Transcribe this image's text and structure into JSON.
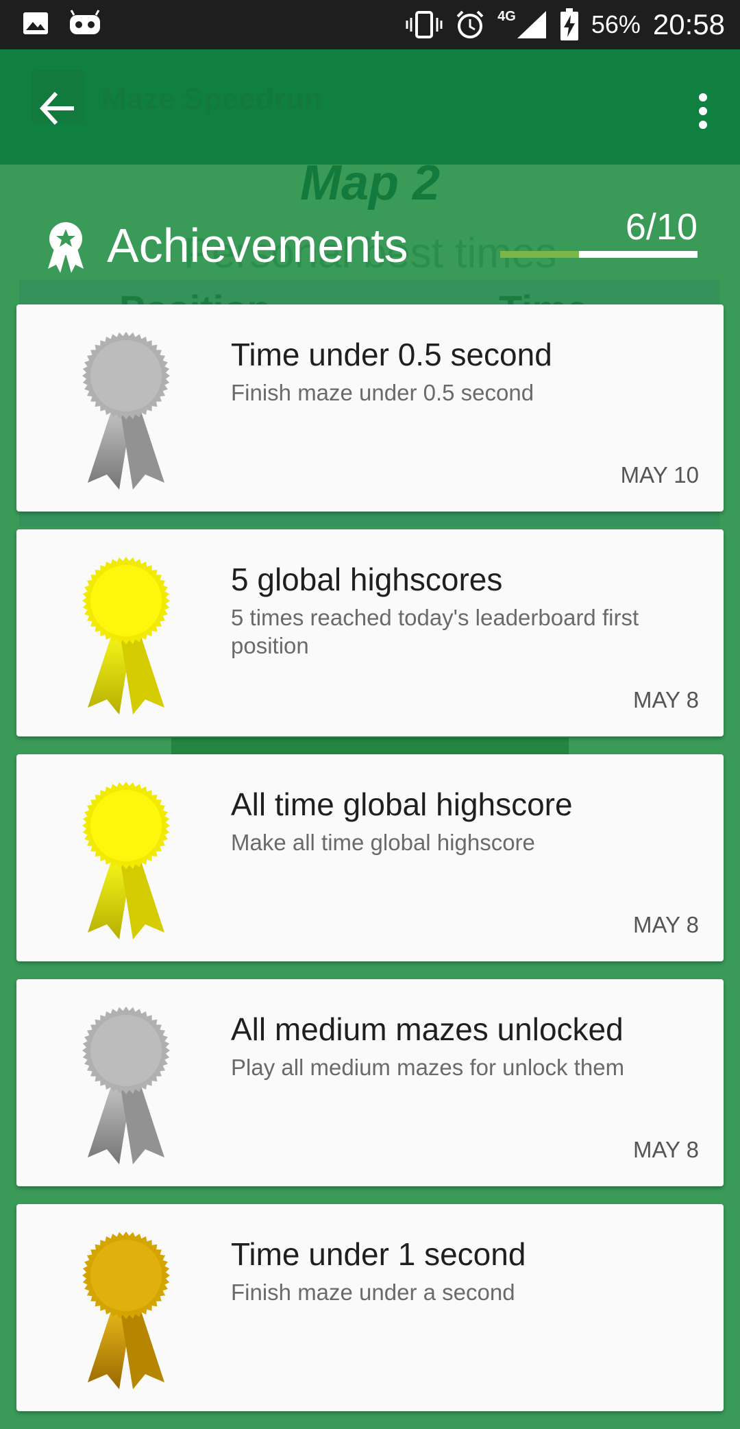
{
  "status_bar": {
    "battery": "56%",
    "network": "4G",
    "time": "20:58"
  },
  "app": {
    "title": "Maze Speedrun",
    "map_heading": "Map 2",
    "section_heading": "Personal best times",
    "col_position": "Position",
    "col_time": "Time"
  },
  "achievements": {
    "title": "Achievements",
    "count": "6/10",
    "progress_fraction": 0.6,
    "items": [
      {
        "title": "Time under 0.5 second",
        "description": "Finish maze under 0.5 second",
        "date": "MAY 10",
        "medal": "silver"
      },
      {
        "title": "5 global highscores",
        "description": "5 times reached today's leaderboard first position",
        "date": "MAY 8",
        "medal": "yellow"
      },
      {
        "title": "All time global highscore",
        "description": "Make all time global highscore",
        "date": "MAY 8",
        "medal": "yellow"
      },
      {
        "title": "All medium mazes unlocked",
        "description": "Play all medium mazes for unlock them",
        "date": "MAY 8",
        "medal": "silver"
      },
      {
        "title": "Time under 1 second",
        "description": "Finish maze under a second",
        "date": "",
        "medal": "gold"
      }
    ]
  },
  "colors": {
    "appbar": "#0f8040",
    "overlay_bg": "#3a9a58",
    "progress_track": "#7ab648",
    "medal_silver": "#b0b0b0",
    "medal_yellow": "#f2ea00",
    "medal_gold": "#d4a400"
  }
}
